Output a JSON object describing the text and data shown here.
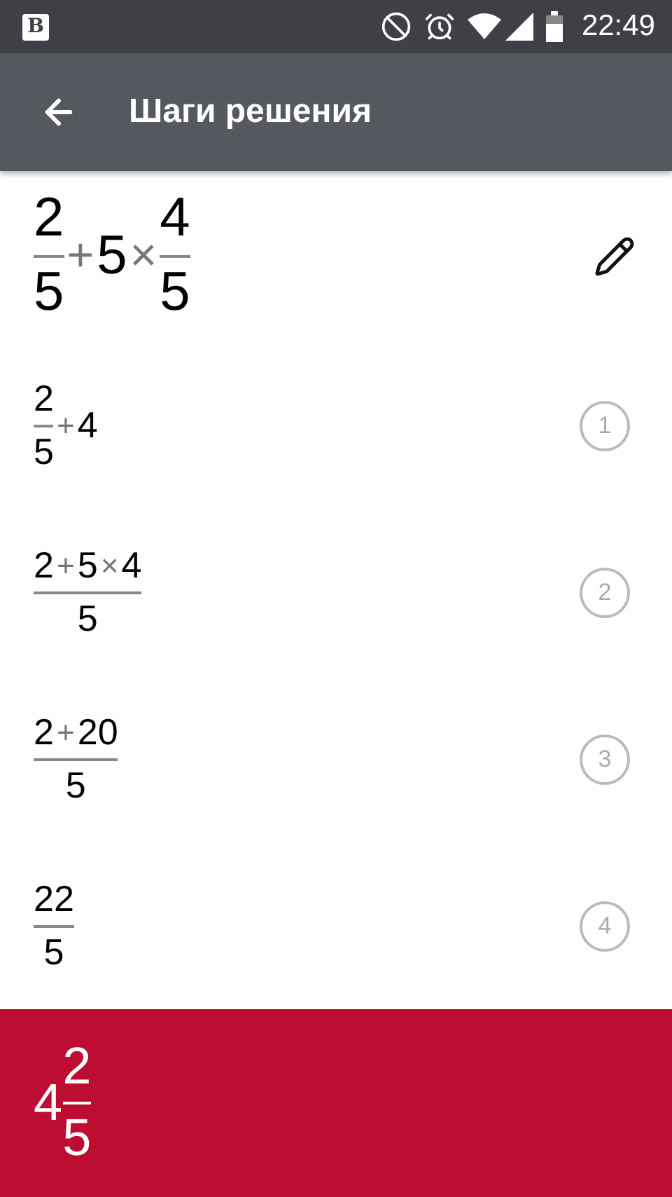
{
  "status_bar": {
    "notification": "B",
    "time": "22:49"
  },
  "app_bar": {
    "title": "Шаги решения"
  },
  "problem": {
    "expr": [
      {
        "kind": "frac",
        "num": [
          {
            "kind": "num",
            "text": "2"
          }
        ],
        "den": [
          {
            "kind": "num",
            "text": "5"
          }
        ]
      },
      {
        "kind": "op",
        "text": "+"
      },
      {
        "kind": "num",
        "text": "5"
      },
      {
        "kind": "op",
        "text": "×"
      },
      {
        "kind": "frac",
        "num": [
          {
            "kind": "num",
            "text": "4"
          }
        ],
        "den": [
          {
            "kind": "num",
            "text": "5"
          }
        ]
      }
    ]
  },
  "steps": [
    {
      "number": "1",
      "expr": [
        {
          "kind": "frac",
          "num": [
            {
              "kind": "num",
              "text": "2"
            }
          ],
          "den": [
            {
              "kind": "num",
              "text": "5"
            }
          ]
        },
        {
          "kind": "op",
          "text": "+"
        },
        {
          "kind": "num",
          "text": "4"
        }
      ]
    },
    {
      "number": "2",
      "expr": [
        {
          "kind": "frac",
          "num": [
            {
              "kind": "num",
              "text": "2"
            },
            {
              "kind": "op",
              "text": "+"
            },
            {
              "kind": "num",
              "text": "5"
            },
            {
              "kind": "op",
              "text": "×"
            },
            {
              "kind": "num",
              "text": "4"
            }
          ],
          "den": [
            {
              "kind": "num",
              "text": "5"
            }
          ]
        }
      ]
    },
    {
      "number": "3",
      "expr": [
        {
          "kind": "frac",
          "num": [
            {
              "kind": "num",
              "text": "2"
            },
            {
              "kind": "op",
              "text": "+"
            },
            {
              "kind": "num",
              "text": "20"
            }
          ],
          "den": [
            {
              "kind": "num",
              "text": "5"
            }
          ]
        }
      ]
    },
    {
      "number": "4",
      "expr": [
        {
          "kind": "frac",
          "num": [
            {
              "kind": "num",
              "text": "22"
            }
          ],
          "den": [
            {
              "kind": "num",
              "text": "5"
            }
          ]
        }
      ]
    }
  ],
  "result": {
    "expr": [
      {
        "kind": "num",
        "text": "4"
      },
      {
        "kind": "frac",
        "num": [
          {
            "kind": "num",
            "text": "2"
          }
        ],
        "den": [
          {
            "kind": "num",
            "text": "5"
          }
        ]
      }
    ]
  }
}
